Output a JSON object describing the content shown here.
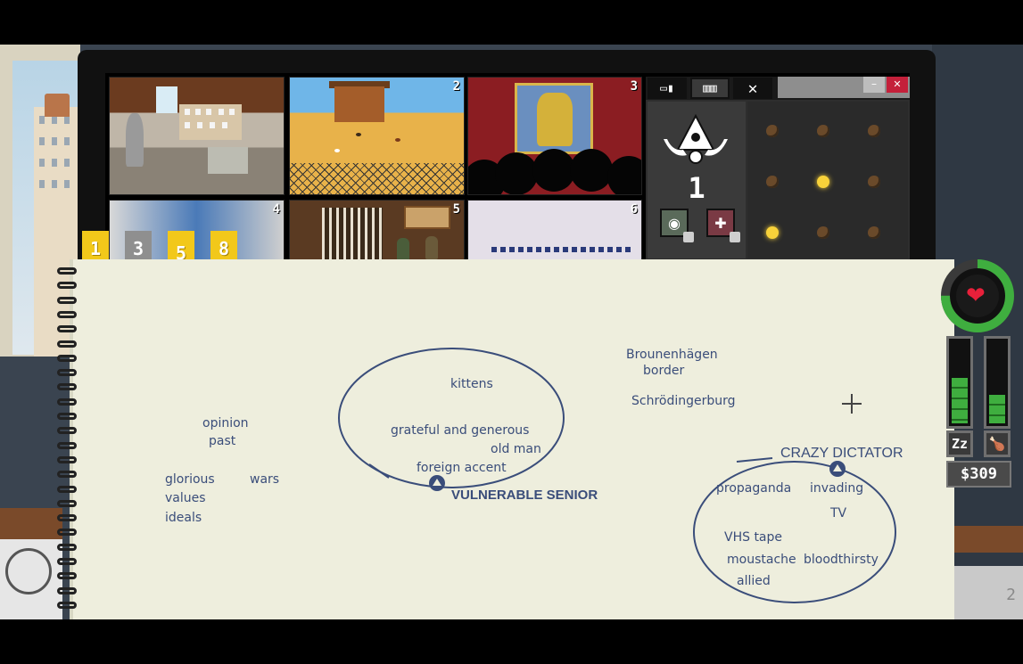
{
  "cameras": [
    {
      "number": "",
      "label": "attic-studio"
    },
    {
      "number": "2",
      "label": "chicken-yard"
    },
    {
      "number": "3",
      "label": "pharaoh-theater"
    },
    {
      "number": "4",
      "label": "lab-room"
    },
    {
      "number": "5",
      "label": "study-room"
    },
    {
      "number": "6",
      "label": "airship"
    }
  ],
  "camera_tabs": [
    "1",
    "3",
    "5",
    "8"
  ],
  "panel": {
    "tabs": [
      {
        "icon": "camera-icon"
      },
      {
        "icon": "film-reel-icon"
      },
      {
        "label": "✕",
        "icon": "close-tab-icon"
      }
    ],
    "minimize_label": "–",
    "close_label": "✕",
    "level": "1",
    "lights": [
      false,
      false,
      false,
      false,
      true,
      false,
      true,
      false,
      false
    ]
  },
  "notebook": {
    "words": {
      "kittens": "kittens",
      "grateful": "grateful and generous",
      "old_man": "old man",
      "foreign_accent": "foreign accent",
      "brounenhagen": "Brounenhägen",
      "border": "border",
      "schrodingerburg": "Schrödingerburg",
      "opinion": "opinion",
      "past": "past",
      "glorious": "glorious",
      "values": "values",
      "ideals": "ideals",
      "wars": "wars",
      "propaganda": "propaganda",
      "invading": "invading",
      "tv": "TV",
      "vhs_tape": "VHS tape",
      "moustache": "moustache",
      "bloodthirsty": "bloodthirsty",
      "allied": "allied"
    },
    "categories": {
      "vulnerable_senior": "VULNERABLE SENIOR",
      "crazy_dictator": "CRAZY DICTATOR"
    }
  },
  "hud": {
    "health_fraction": 0.75,
    "sleep_fraction": 0.55,
    "food_fraction": 0.35,
    "sleep_icon_label": "Zz",
    "food_icon_label": "🍗",
    "money": "$309",
    "heart_glyph": "❤"
  },
  "colors": {
    "ink": "#3a4d7a",
    "tab_yellow": "#f2c81a",
    "health_green": "#3fae3f",
    "close_red": "#c4203a"
  }
}
